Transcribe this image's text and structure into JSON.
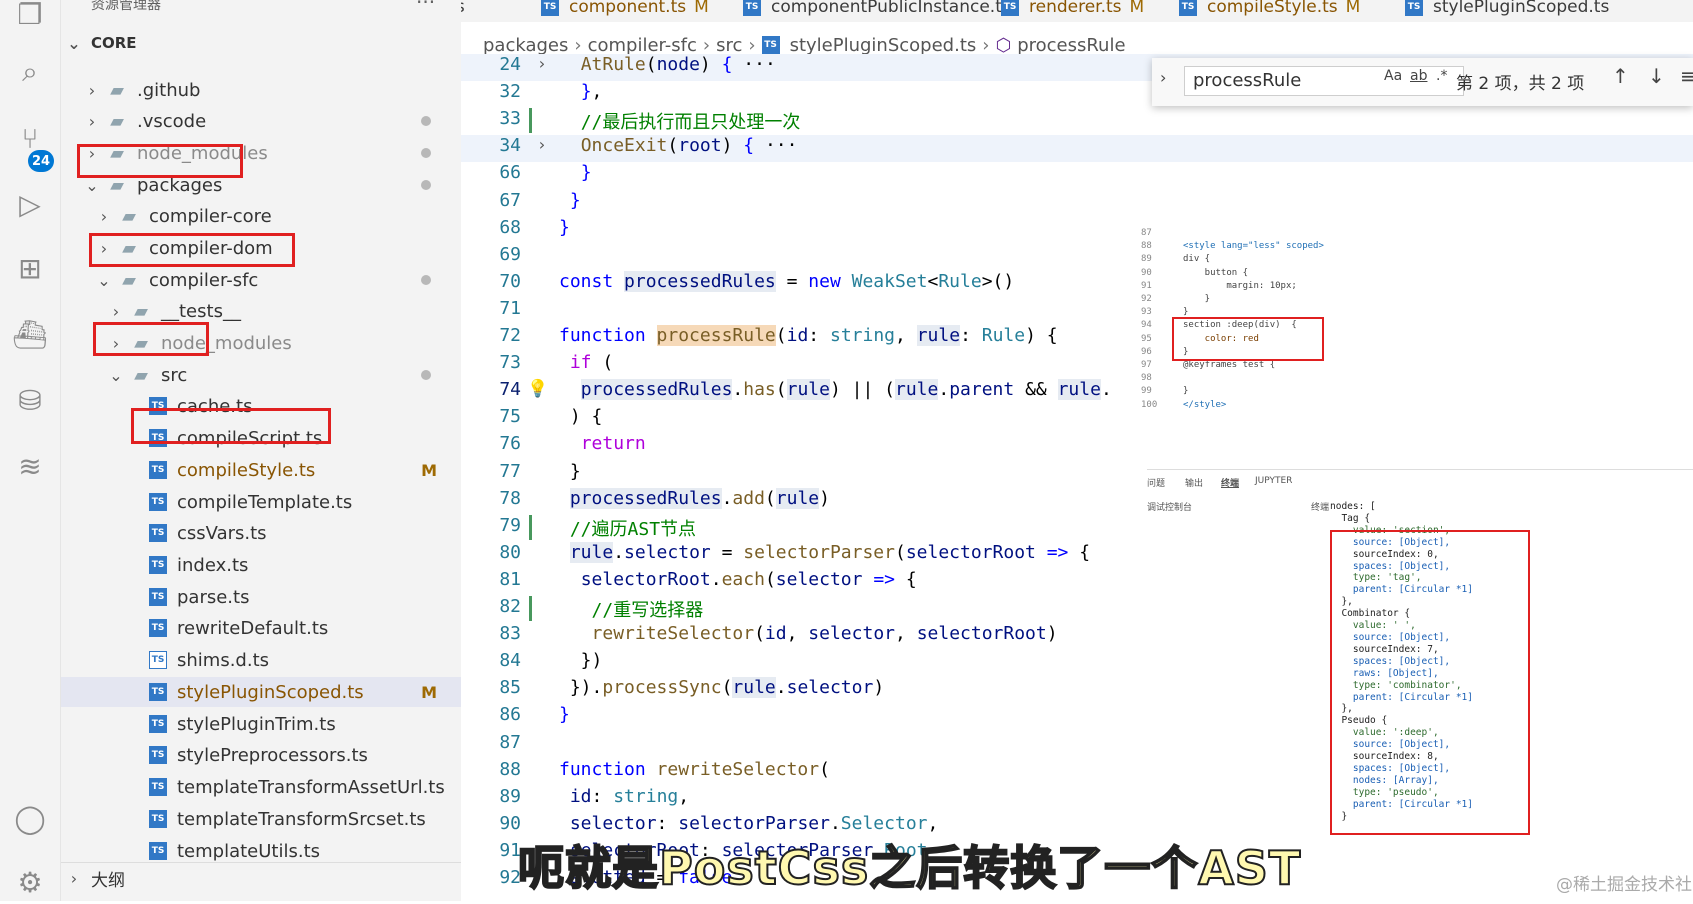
{
  "activity_bar": {
    "icons": [
      "files-icon",
      "search-icon",
      "source-control-icon",
      "run-debug-icon",
      "extensions-icon",
      "docker-icon",
      "database-icon",
      "layers-icon",
      "account-icon",
      "gear-icon"
    ],
    "scm_badge": "24"
  },
  "sidebar": {
    "title": "资源管理器",
    "more": "···",
    "section": "CORE",
    "items": [
      {
        "label": ".github",
        "indent": 1
      },
      {
        "label": ".vscode",
        "indent": 1
      },
      {
        "label": "node_modules",
        "indent": 1
      },
      {
        "label": "packages",
        "indent": 1
      },
      {
        "label": "compiler-core",
        "indent": 2
      },
      {
        "label": "compiler-dom",
        "indent": 2
      },
      {
        "label": "compiler-sfc",
        "indent": 2
      },
      {
        "label": "__tests__",
        "indent": 3
      },
      {
        "label": "node_modules",
        "indent": 3
      },
      {
        "label": "src",
        "indent": 3
      },
      {
        "label": "cache.ts",
        "indent": 4
      },
      {
        "label": "compileScript.ts",
        "indent": 4
      },
      {
        "label": "compileStyle.ts",
        "indent": 4,
        "status": "M"
      },
      {
        "label": "compileTemplate.ts",
        "indent": 4
      },
      {
        "label": "cssVars.ts",
        "indent": 4
      },
      {
        "label": "index.ts",
        "indent": 4
      },
      {
        "label": "parse.ts",
        "indent": 4
      },
      {
        "label": "rewriteDefault.ts",
        "indent": 4
      },
      {
        "label": "shims.d.ts",
        "indent": 4
      },
      {
        "label": "stylePluginScoped.ts",
        "indent": 4,
        "status": "M"
      },
      {
        "label": "stylePluginTrim.ts",
        "indent": 4
      },
      {
        "label": "stylePreprocessors.ts",
        "indent": 4
      },
      {
        "label": "templateTransformAssetUrl.ts",
        "indent": 4
      },
      {
        "label": "templateTransformSrcset.ts",
        "indent": 4
      },
      {
        "label": "templateUtils.ts",
        "indent": 4
      }
    ],
    "outline_label": "大纲"
  },
  "tabs": [
    {
      "label": "p.ts",
      "modified": ""
    },
    {
      "label": "component.ts",
      "modified": "M"
    },
    {
      "label": "componentPublicInstance.ts",
      "modified": ""
    },
    {
      "label": "renderer.ts",
      "modified": "M"
    },
    {
      "label": "compileStyle.ts",
      "modified": "M"
    },
    {
      "label": "stylePluginScoped.ts",
      "modified": ""
    }
  ],
  "breadcrumbs": [
    "packages",
    "compiler-sfc",
    "src",
    "stylePluginScoped.ts",
    "processRule"
  ],
  "find": {
    "query": "processRule",
    "opt_case": "Aa",
    "opt_word": "ab",
    "opt_regex": ".*",
    "count": "第 2 项，共 2 项"
  },
  "line_numbers": [
    "24",
    "32",
    "33",
    "34",
    "66",
    "67",
    "68",
    "69",
    "70",
    "71",
    "72",
    "73",
    "74",
    "75",
    "76",
    "77",
    "78",
    "79",
    "80",
    "81",
    "82",
    "83",
    "84",
    "85",
    "86",
    "87",
    "88",
    "89",
    "90",
    "91",
    "92"
  ],
  "overlay": {
    "line_numbers": [
      "87",
      "88",
      "89",
      "90",
      "91",
      "92",
      "93",
      "94",
      "95",
      "96",
      "97",
      "98",
      "99",
      "100"
    ],
    "code_lines": [
      "",
      "<style lang=\"less\" scoped>",
      "div {",
      "    button {",
      "        margin: 10px;",
      "    }",
      "}",
      "section :deep(div)  {",
      "    color: red",
      "}",
      "@keyframes test {",
      "",
      "}",
      "</style>"
    ],
    "panel_tabs": [
      "问题",
      "输出",
      "终端",
      "JUPYTER"
    ],
    "debug_console": "调试控制台",
    "terminal": "终端",
    "ast_lines": [
      "nodes: [",
      "  Tag {",
      "    value: 'section',",
      "    source: [Object],",
      "    sourceIndex: 0,",
      "    spaces: [Object],",
      "    type: 'tag',",
      "    parent: [Circular *1]",
      "  },",
      "  Combinator {",
      "    value: ' ',",
      "    source: [Object],",
      "    sourceIndex: 7,",
      "    spaces: [Object],",
      "    raws: [Object],",
      "    type: 'combinator',",
      "    parent: [Circular *1]",
      "  },",
      "  Pseudo {",
      "    value: ':deep',",
      "    source: [Object],",
      "    sourceIndex: 8,",
      "    spaces: [Object],",
      "    nodes: [Array],",
      "    type: 'pseudo',",
      "    parent: [Circular *1]",
      "  }"
    ]
  },
  "subtitle": "呃就是PostCss之后转换了一个AST",
  "watermark": "@稀土掘金技术社区",
  "colors": {
    "highlight": "#e02020",
    "accent": "#0078d4"
  }
}
